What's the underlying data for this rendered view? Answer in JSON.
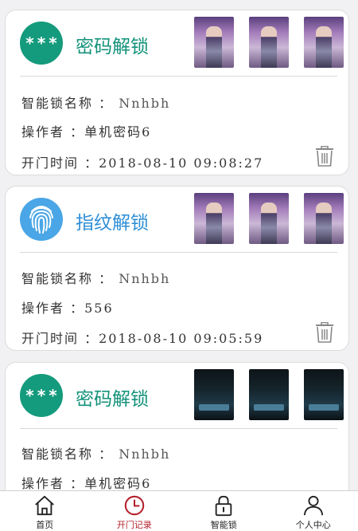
{
  "records": [
    {
      "type_label": "密码解锁",
      "badge_text": "***",
      "badge_kind": "password",
      "lock_name_label": "智能锁名称 ：",
      "lock_name": "Nnhbh",
      "operator_label": "操作者 ：",
      "operator": "单机密码6",
      "time_label": "开门时间 ：",
      "time": "2018-08-10 09:08:27",
      "thumb_style": "day"
    },
    {
      "type_label": "指纹解锁",
      "badge_text": "",
      "badge_kind": "fingerprint",
      "lock_name_label": "智能锁名称 ：",
      "lock_name": "Nnhbh",
      "operator_label": "操作者 ：",
      "operator": "556",
      "time_label": "开门时间 ：",
      "time": "2018-08-10 09:05:59",
      "thumb_style": "day"
    },
    {
      "type_label": "密码解锁",
      "badge_text": "***",
      "badge_kind": "password",
      "lock_name_label": "智能锁名称 ：",
      "lock_name": "Nnhbh",
      "operator_label": "操作者 ：",
      "operator": "单机密码6",
      "time_label": "",
      "time": "",
      "thumb_style": "night"
    }
  ],
  "tabs": [
    {
      "label": "首页",
      "icon": "home-icon",
      "active": false
    },
    {
      "label": "开门记录",
      "icon": "clock-icon",
      "active": true
    },
    {
      "label": "智能锁",
      "icon": "lock-icon",
      "active": false
    },
    {
      "label": "个人中心",
      "icon": "person-icon",
      "active": false
    }
  ],
  "colors": {
    "password_badge": "#149a7c",
    "fingerprint_badge": "#4aa6e6",
    "active_tab": "#b3202a"
  }
}
